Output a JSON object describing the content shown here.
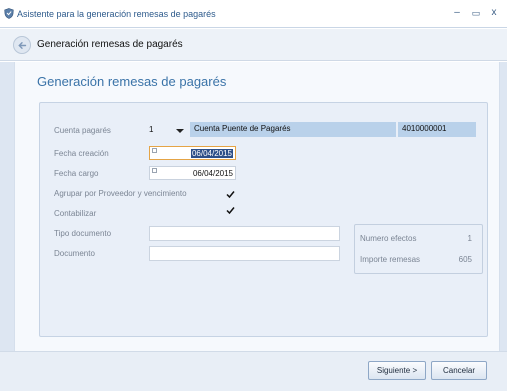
{
  "window": {
    "title": "Asistente para la generación remesas de pagarés",
    "controls": {
      "minimize": "–",
      "maximize": "▭",
      "close": "x"
    }
  },
  "nav": {
    "title": "Generación remesas de pagarés"
  },
  "page": {
    "heading": "Generación remesas de pagarés"
  },
  "form": {
    "cuenta_label": "Cuenta pagarés",
    "cuenta_value": "1",
    "cuenta_name": "Cuenta Puente de Pagarés",
    "cuenta_code": "4010000001",
    "fecha_creacion_label": "Fecha creación",
    "fecha_creacion_value": "06/04/2015",
    "fecha_cargo_label": "Fecha cargo",
    "fecha_cargo_value": "06/04/2015",
    "agrupar_label": "Agrupar por Proveedor y vencimiento",
    "agrupar_checked": true,
    "contabilizar_label": "Contabilizar",
    "contabilizar_checked": true,
    "tipo_documento_label": "Tipo documento",
    "tipo_documento_value": "",
    "documento_label": "Documento",
    "documento_value": ""
  },
  "summary": {
    "numero_efectos_label": "Numero efectos",
    "numero_efectos_value": "1",
    "importe_remesas_label": "Importe remesas",
    "importe_remesas_value": "605"
  },
  "footer": {
    "next_label": "Siguiente >",
    "cancel_label": "Cancelar"
  },
  "colors": {
    "accent": "#3a73a8",
    "highlight": "#b9d1ea",
    "selection": "#2d4f88"
  }
}
